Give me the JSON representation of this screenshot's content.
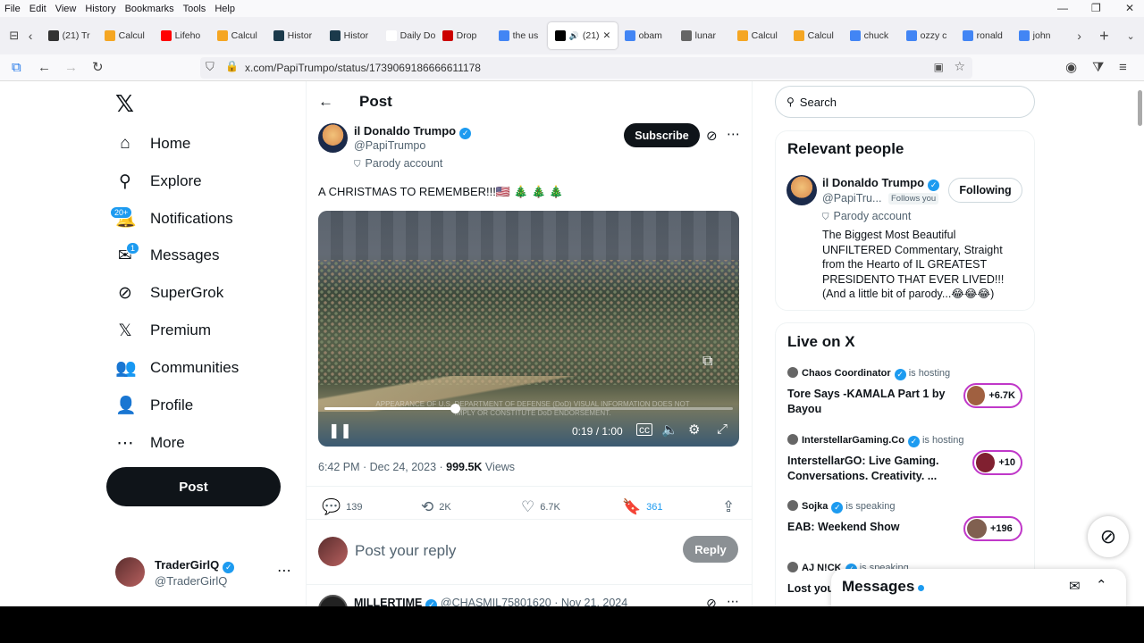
{
  "menubar": {
    "items": [
      "File",
      "Edit",
      "View",
      "History",
      "Bookmarks",
      "Tools",
      "Help"
    ]
  },
  "tabs": [
    {
      "label": "(21) Tr",
      "color": "#333"
    },
    {
      "label": "Calcul",
      "color": "#f5a623"
    },
    {
      "label": "Lifeho",
      "color": "#ff0000"
    },
    {
      "label": "Calcul",
      "color": "#f5a623"
    },
    {
      "label": "Histor",
      "color": "#1b3a4b"
    },
    {
      "label": "Histor",
      "color": "#1b3a4b"
    },
    {
      "label": "Daily Dose",
      "color": "#ffffff"
    },
    {
      "label": "Drop",
      "color": "#c00"
    },
    {
      "label": "the us",
      "color": "#4285f4"
    },
    {
      "label": "(21)",
      "color": "#000",
      "active": true
    },
    {
      "label": "obam",
      "color": "#4285f4"
    },
    {
      "label": "lunar",
      "color": "#666"
    },
    {
      "label": "Calcul",
      "color": "#f5a623"
    },
    {
      "label": "Calcul",
      "color": "#f5a623"
    },
    {
      "label": "chuck",
      "color": "#4285f4"
    },
    {
      "label": "ozzy c",
      "color": "#4285f4"
    },
    {
      "label": "ronald",
      "color": "#4285f4"
    },
    {
      "label": "john",
      "color": "#4285f4"
    }
  ],
  "url": "x.com/PapiTrumpo/status/1739069186666611178",
  "sidebar": {
    "items": [
      {
        "label": "Home",
        "icon": "home-icon",
        "glyph": "⌂"
      },
      {
        "label": "Explore",
        "icon": "search-icon",
        "glyph": "⚲"
      },
      {
        "label": "Notifications",
        "icon": "bell-icon",
        "glyph": "🔔"
      },
      {
        "label": "Messages",
        "icon": "mail-icon",
        "glyph": "✉"
      },
      {
        "label": "SuperGrok",
        "icon": "grok-icon",
        "glyph": "⊘"
      },
      {
        "label": "Premium",
        "icon": "x-logo-icon",
        "glyph": "𝕏"
      },
      {
        "label": "Communities",
        "icon": "communities-icon",
        "glyph": "👥"
      },
      {
        "label": "Profile",
        "icon": "profile-icon",
        "glyph": "👤"
      },
      {
        "label": "More",
        "icon": "more-icon",
        "glyph": "⋯"
      }
    ],
    "notif_badge": "20+",
    "msg_badge": "1",
    "post_label": "Post",
    "account": {
      "name": "TraderGirlQ",
      "handle": "@TraderGirlQ"
    }
  },
  "header": {
    "title": "Post"
  },
  "tweet": {
    "author": "il Donaldo Trumpo",
    "handle": "@PapiTrumpo",
    "parody": "Parody account",
    "subscribe": "Subscribe",
    "text": "A CHRISTMAS TO REMEMBER!!!🇺🇸 🎄 🎄 🎄",
    "video": {
      "time": "0:19 / 1:00",
      "caption": "APPEARANCE OF U.S. DEPARTMENT OF DEFENSE (DoD) VISUAL INFORMATION DOES NOT IMPLY OR CONSTITUTE DoD ENDORSEMENT.",
      "progress": 0.32
    },
    "timestamp": "6:42 PM · Dec 24, 2023 · ",
    "views": "999.5K",
    "views_label": " Views",
    "stats": {
      "replies": "139",
      "reposts": "2K",
      "likes": "6.7K",
      "bookmarks": "361"
    },
    "reply_placeholder": "Post your reply",
    "reply_button": "Reply"
  },
  "next_reply": {
    "name": "MILLERTIME",
    "handle": "@CHASMIL75801620 · Nov 21, 2024"
  },
  "right": {
    "search_placeholder": "Search",
    "relevant_title": "Relevant people",
    "person": {
      "name": "il Donaldo Trumpo",
      "handle": "@PapiTru...",
      "follows": "Follows you",
      "parody": "Parody account",
      "follow_btn": "Following",
      "bio": "The Biggest Most Beautiful UNFILTERED Commentary, Straight from the Hearto of IL GREATEST PRESIDENTO THAT EVER LIVED!!! (And a little bit of parody...😂😂😂)"
    },
    "live_title": "Live on X",
    "live": [
      {
        "host": "Chaos Coordinator",
        "status": "is hosting",
        "title": "Tore Says -KAMALA Part 1 by Bayou",
        "count": "+6.7K"
      },
      {
        "host": "InterstellarGaming.Co",
        "status": "is hosting",
        "title": "InterstellarGO: Live Gaming. Conversations. Creativity. ...",
        "count": "+10"
      },
      {
        "host": "Sojka",
        "status": "is speaking",
        "title": "EAB: Weekend Show",
        "count": "+196"
      },
      {
        "host": "AJ N!CK",
        "status": "is speaking",
        "title": "Lost you"
      }
    ],
    "messages_title": "Messages"
  }
}
